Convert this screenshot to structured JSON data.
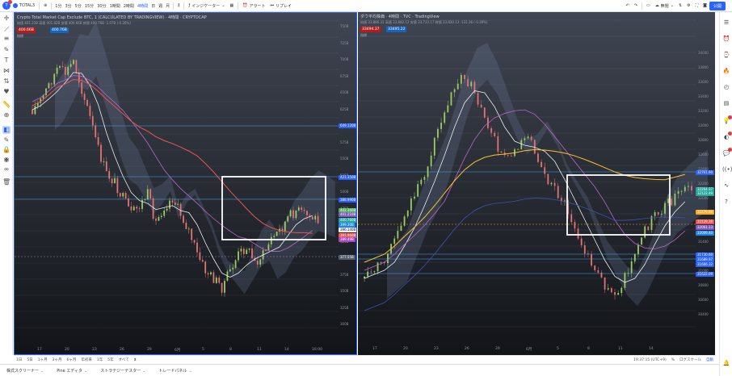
{
  "toolbar": {
    "symbol": "TOTAL3",
    "intervals": [
      "1分",
      "3分",
      "5分",
      "15分",
      "30分",
      "1時間",
      "2時間",
      "4時間",
      "日",
      "週",
      "月"
    ],
    "active_interval": "4時間",
    "indicators_label": "インジケーター",
    "alert_label": "アラート",
    "replay_label": "リプレイ",
    "no_title_label": "無題",
    "publish_label": "公開"
  },
  "left_chart": {
    "title": "Crypto Total Market Cap Exclude BTC, 1 (CALCULATED BY TRADINGVIEW) · 4時間 · CRYPTOCAP",
    "ohlc": "始値 401.21B  高値 401.82B  安値 400.66B  終値 400.76B  -1.07B (-0.26%)",
    "sell_box": "400.66B",
    "buy_box": "400.76B",
    "extra": "指標",
    "price_scale": [
      "750B",
      "725B",
      "700B",
      "675B",
      "650B",
      "625B",
      "600B",
      "575B",
      "550B",
      "525B",
      "500B",
      "475B",
      "450B",
      "425B",
      "400B",
      "375B",
      "350B",
      "325B",
      "300B"
    ],
    "levels": [
      {
        "label": "649.120B",
        "color": "#2962ff"
      },
      {
        "label": "421.350B",
        "color": "#2962ff"
      },
      {
        "label": "388.990B",
        "color": "#2962ff"
      },
      {
        "label": "402.360B",
        "color": "#4caf50"
      },
      {
        "label": "401.210B",
        "color": "#7e57c2"
      },
      {
        "label": "400.760B",
        "color": "#26a69a"
      },
      {
        "label": "399.30B",
        "color": "#1e88e5"
      },
      {
        "label": "396.140B",
        "color": "#eeeeee"
      },
      {
        "label": "391.960B",
        "color": "#ef5350"
      },
      {
        "label": "389.49B",
        "color": "#ab47bc"
      },
      {
        "label": "377.55B",
        "color": "#555c69"
      }
    ],
    "time_labels": [
      "17",
      "20",
      "23",
      "26",
      "29",
      "6月",
      "5",
      "8",
      "11",
      "14",
      "16:00"
    ]
  },
  "right_chart": {
    "title": "ダウ平均株価 · 4時間 · TVC · TradingView",
    "ohlc": "始値 33,886.31  高値 33,882.12  安値 33,733.17  終値 33,830.13  -131.36 (-0.39%)",
    "sell_box": "33494.37",
    "buy_box": "33495.22",
    "extra": "指標",
    "price_scale": [
      "34000",
      "33800",
      "33600",
      "33400",
      "33200",
      "33000",
      "32800",
      "32600",
      "32400",
      "32200",
      "32000",
      "31800",
      "31600",
      "31400",
      "31200",
      "31000",
      "30800",
      "30600",
      "30400"
    ],
    "levels": [
      {
        "label": "32761.90",
        "color": "#2962ff"
      },
      {
        "label": "32264.37",
        "color": "#26a69a"
      },
      {
        "label": "32122.49",
        "color": "#26a69a"
      },
      {
        "label": "32279.89",
        "color": "#f9a825"
      },
      {
        "label": "32129.38",
        "color": "#ef5350"
      },
      {
        "label": "32061.13",
        "color": "#7e57c2"
      },
      {
        "label": "32009.40",
        "color": "#1e88e5"
      },
      {
        "label": "31730.60",
        "color": "#2962ff"
      },
      {
        "label": "31689.97",
        "color": "#2962ff"
      },
      {
        "label": "31666.32",
        "color": "#2962ff"
      },
      {
        "label": "31622.09",
        "color": "#2962ff"
      }
    ],
    "time_labels": [
      "17",
      "20",
      "23",
      "26",
      "29",
      "6月",
      "5",
      "8",
      "11",
      "14"
    ]
  },
  "range_bar": {
    "ranges": [
      "1日",
      "5日",
      "1ヶ月",
      "3ヶ月",
      "6ヶ月",
      "年初来",
      "1年",
      "5年",
      "すべて"
    ],
    "clock": "19:37:15 (UTC+9)",
    "pct": "%",
    "log": "ログスケール",
    "auto": "自動"
  },
  "bottom_bar": {
    "tabs": [
      "株式スクリーナー",
      "Pine エディタ",
      "ストラテジーテスター",
      "トレードパネル"
    ]
  }
}
